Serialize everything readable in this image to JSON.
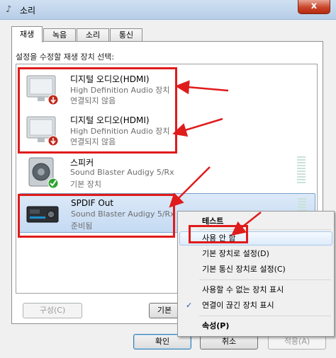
{
  "window": {
    "title": "소리",
    "close_label": "x"
  },
  "tabs": [
    {
      "label": "재생",
      "active": true
    },
    {
      "label": "녹음",
      "active": false
    },
    {
      "label": "소리",
      "active": false
    },
    {
      "label": "통신",
      "active": false
    }
  ],
  "instruction": "설정을 수정할 재생 장치 선택:",
  "devices": [
    {
      "name": "디지털 오디오(HDMI)",
      "description": "High Definition Audio 장치",
      "status": "연결되지 않음",
      "icon": "monitor-disconnected-icon",
      "selected": false
    },
    {
      "name": "디지털 오디오(HDMI)",
      "description": "High Definition Audio 장치",
      "status": "연결되지 않음",
      "icon": "monitor-disconnected-icon",
      "selected": false
    },
    {
      "name": "스피커",
      "description": "Sound Blaster Audigy 5/Rx",
      "status": "기본 장치",
      "icon": "speaker-default-icon",
      "selected": false
    },
    {
      "name": "SPDIF Out",
      "description": "Sound Blaster Audigy 5/Rx",
      "status": "준비됨",
      "icon": "spdif-device-icon",
      "selected": true
    }
  ],
  "buttons": {
    "configure": "구성(C)",
    "set_default": "기본",
    "ok": "확인",
    "cancel": "취소",
    "apply": "적용(A)"
  },
  "context_menu": {
    "items": [
      {
        "label": "테스트",
        "bold": true
      },
      {
        "label": "사용 안 함",
        "hover": true
      },
      {
        "label": "기본 장치로 설정(D)"
      },
      {
        "label": "기본 통신 장치로 설정(C)"
      },
      {
        "label": "사용할 수 없는 장치 표시"
      },
      {
        "label": "연결이 끊긴 장치 표시",
        "checked": true
      },
      {
        "label": "속성(P)",
        "bold": true
      }
    ]
  },
  "colors": {
    "annotation": "#e01b1b",
    "selection": "#c4daf3",
    "check": "#1a5ea8"
  }
}
